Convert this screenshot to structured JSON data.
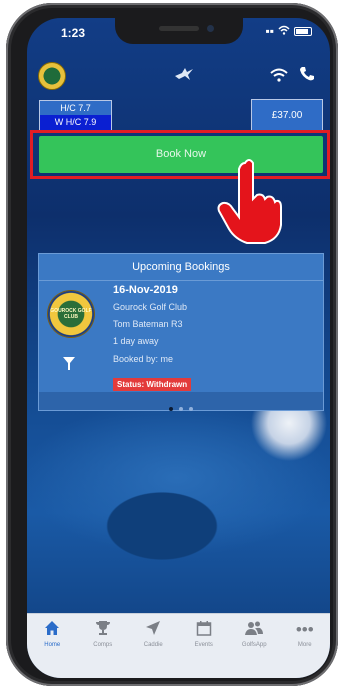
{
  "status_bar": {
    "time": "1:23"
  },
  "header": {
    "handicap": "H/C 7.7",
    "w_handicap": "W H/C 7.9",
    "balance": "£37.00"
  },
  "book_button_label": "Book Now",
  "upcoming": {
    "title": "Upcoming Bookings",
    "logo_text": "GOUROCK GOLF CLUB",
    "date": "16-Nov-2019",
    "club": "Gourock Golf Club",
    "player": "Tom Bateman R3",
    "days_away": "1 day away",
    "booked_by": "Booked by: me",
    "status": "Status: Withdrawn",
    "page_count": 3,
    "active_page": 1
  },
  "tabs": [
    {
      "label": "Home",
      "icon": "house-icon",
      "active": true
    },
    {
      "label": "Comps",
      "icon": "trophy-icon",
      "active": false
    },
    {
      "label": "Caddie",
      "icon": "navigation-arrow-icon",
      "active": false
    },
    {
      "label": "Events",
      "icon": "calendar-icon",
      "active": false
    },
    {
      "label": "GolfsApp",
      "icon": "users-icon",
      "active": false
    },
    {
      "label": "More",
      "icon": "more-dots-icon",
      "active": false
    }
  ],
  "colors": {
    "accent": "#2a6cc9",
    "book_green": "#34c45a",
    "highlight_red": "#e21d24",
    "status_red": "#e33b3b"
  }
}
